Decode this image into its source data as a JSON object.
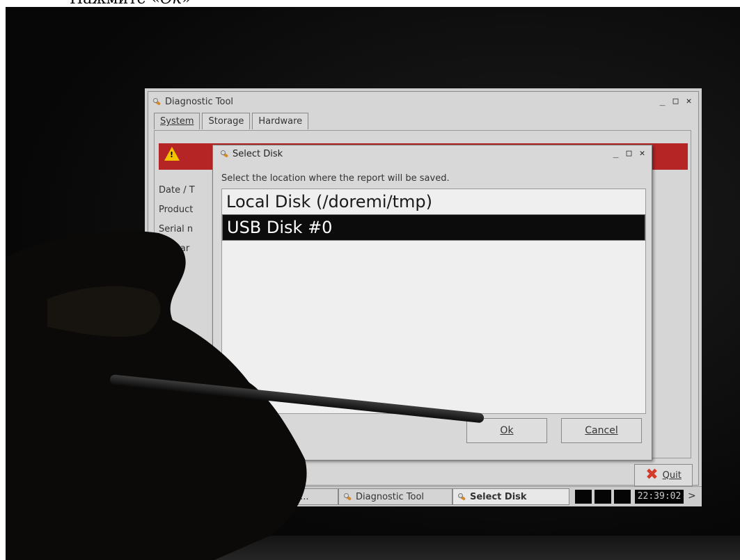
{
  "caption": {
    "prefix": "Нажмите «",
    "emph": "Ok",
    "suffix": "»"
  },
  "main_window": {
    "title": "Diagnostic Tool",
    "controls": [
      "_",
      "□",
      "✕"
    ],
    "tabs": [
      "System",
      "Storage",
      "Hardware"
    ],
    "side_labels": [
      "Date / T",
      "Product",
      "Serial n",
      "nwar",
      "ar"
    ],
    "quit_label": "Quit"
  },
  "dialog": {
    "title": "Select Disk",
    "controls": [
      "_",
      "□",
      "✕"
    ],
    "message": "Select the location where the report will be saved.",
    "items": [
      "Local Disk (/doremi/tmp)",
      "USB Disk #0"
    ],
    "selected_index": 1,
    "ok_label": "Ok",
    "cancel_label": "Cancel"
  },
  "taskbar": {
    "items": [
      "Doremi Labs -...",
      "Diagnostic Tool",
      "Select Disk"
    ],
    "clock": "22:39:02",
    "more": ">"
  },
  "colors": {
    "alert": "#b62525",
    "selection": "#0c0c0c",
    "warning_icon": "#f3c300",
    "quit_icon": "#d43a2a"
  },
  "icons": [
    "app-icon",
    "warning-icon",
    "quit-icon",
    "doremi-icon"
  ]
}
